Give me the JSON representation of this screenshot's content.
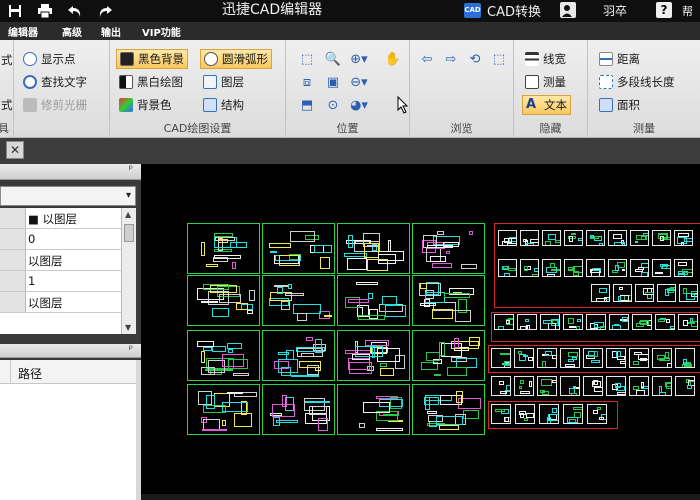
{
  "window": {
    "title": "迅捷CAD编辑器",
    "cad_badge": "CAD",
    "cad_convert": "CAD转换",
    "user_name": "羽卒",
    "help_icon_glyph": "?",
    "help_text": "帮"
  },
  "menu": {
    "tabs": [
      "编辑器",
      "高级",
      "输出",
      "VIP功能"
    ]
  },
  "ribbon": {
    "partial_group": {
      "items": [
        "式",
        "式"
      ],
      "label": "具"
    },
    "view_group": {
      "show_point": "显示点",
      "find_text": "查找文字",
      "edit_light": "修剪光栅"
    },
    "cad_group": {
      "label": "CAD绘图设置",
      "black_bg": "黑色背景",
      "smooth_arc": "圆滑弧形",
      "bw_draw": "黑白绘图",
      "layer": "图层",
      "bg_color": "背景色",
      "structure": "结构"
    },
    "position_group": {
      "label": "位置"
    },
    "browse_group": {
      "label": "浏览"
    },
    "hide_group": {
      "label": "隐藏",
      "line_width": "线宽",
      "measure": "测量",
      "text": "文本"
    },
    "measure_group": {
      "label": "测量",
      "distance": "距离",
      "polyline_length": "多段线长度",
      "area": "面积"
    }
  },
  "doc": {
    "close_glyph": "✕"
  },
  "left_panel": {
    "pin_glyph": "ᵖ",
    "combo_arrow": "▾",
    "properties": [
      {
        "value": "■ 以图层"
      },
      {
        "value": "0"
      },
      {
        "value": "以图层"
      },
      {
        "value": "1"
      },
      {
        "value": "以图层"
      }
    ],
    "file_list_header": "路径"
  },
  "colors": {
    "sheet_border": "#24d44a",
    "detail_frame": "#d42a2a",
    "active_button": "#f8c860"
  }
}
